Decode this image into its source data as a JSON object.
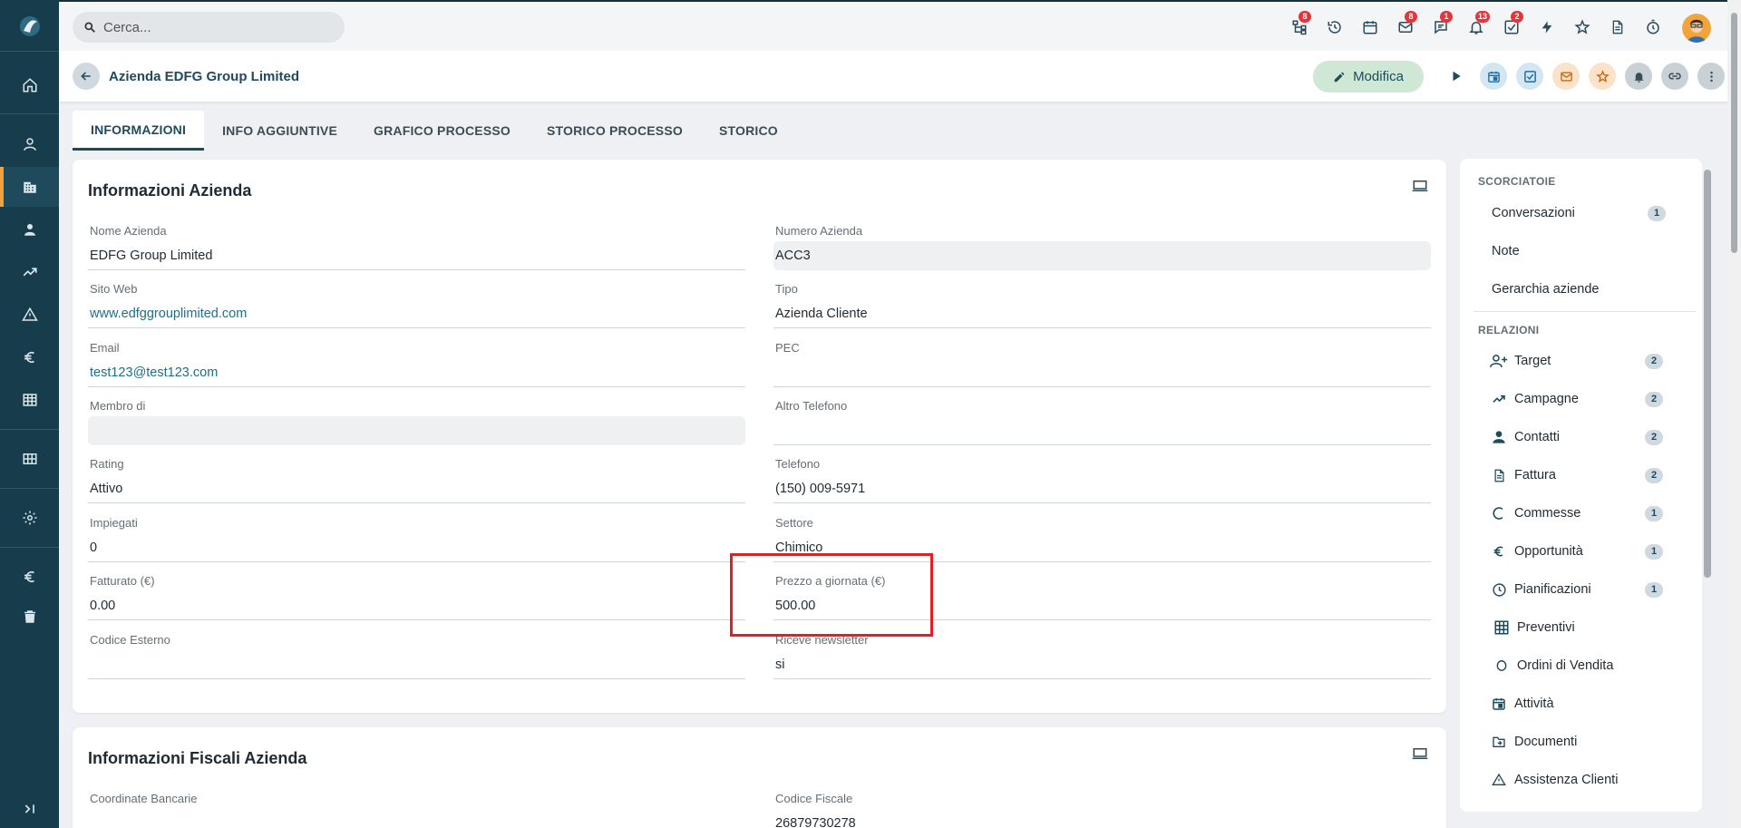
{
  "search": {
    "placeholder": "Cerca..."
  },
  "notifications": {
    "hierarchy_badge": "8",
    "email_badge": "8",
    "chat_badge": "1",
    "bell_badge": "13",
    "tasks_badge": "2"
  },
  "header": {
    "title": "Azienda EDFG Group Limited",
    "edit_label": "Modifica"
  },
  "tabs": [
    {
      "label": "INFORMAZIONI"
    },
    {
      "label": "INFO AGGIUNTIVE"
    },
    {
      "label": "GRAFICO PROCESSO"
    },
    {
      "label": "STORICO PROCESSO"
    },
    {
      "label": "STORICO"
    }
  ],
  "info_card": {
    "title": "Informazioni Azienda",
    "left": [
      {
        "label": "Nome Azienda",
        "value": "EDFG Group Limited"
      },
      {
        "label": "Sito Web",
        "value": "www.edfggrouplimited.com"
      },
      {
        "label": "Email",
        "value": "test123@test123.com"
      },
      {
        "label": "Membro di",
        "value": ""
      },
      {
        "label": "Rating",
        "value": "Attivo"
      },
      {
        "label": "Impiegati",
        "value": "0"
      },
      {
        "label": "Fatturato (€)",
        "value": "0.00"
      },
      {
        "label": "Codice Esterno",
        "value": ""
      }
    ],
    "right": [
      {
        "label": "Numero Azienda",
        "value": "ACC3"
      },
      {
        "label": "Tipo",
        "value": "Azienda Cliente"
      },
      {
        "label": "PEC",
        "value": ""
      },
      {
        "label": "Altro Telefono",
        "value": ""
      },
      {
        "label": "Telefono",
        "value": "(150) 009-5971"
      },
      {
        "label": "Settore",
        "value": "Chimico"
      },
      {
        "label": "Prezzo a giornata (€)",
        "value": "500.00"
      },
      {
        "label": "Riceve newsletter",
        "value": "si"
      }
    ]
  },
  "fiscal_card": {
    "title": "Informazioni Fiscali Azienda",
    "left": [
      {
        "label": "Coordinate Bancarie",
        "value": ""
      }
    ],
    "right": [
      {
        "label": "Codice Fiscale",
        "value": "26879730278"
      }
    ]
  },
  "right_panel": {
    "shortcuts_title": "SCORCIATOIE",
    "shortcuts": [
      {
        "label": "Conversazioni",
        "count": "1"
      },
      {
        "label": "Note"
      },
      {
        "label": "Gerarchia aziende"
      }
    ],
    "relations_title": "RELAZIONI",
    "relations": [
      {
        "label": "Target",
        "count": "2"
      },
      {
        "label": "Campagne",
        "count": "2"
      },
      {
        "label": "Contatti",
        "count": "2"
      },
      {
        "label": "Fattura",
        "count": "2"
      },
      {
        "label": "Commesse",
        "count": "1"
      },
      {
        "label": "Opportunità",
        "count": "1"
      },
      {
        "label": "Pianificazioni",
        "count": "1"
      },
      {
        "label": "Preventivi"
      },
      {
        "label": "Ordini di Vendita"
      },
      {
        "label": "Attività"
      },
      {
        "label": "Documenti"
      },
      {
        "label": "Assistenza Clienti"
      }
    ]
  }
}
